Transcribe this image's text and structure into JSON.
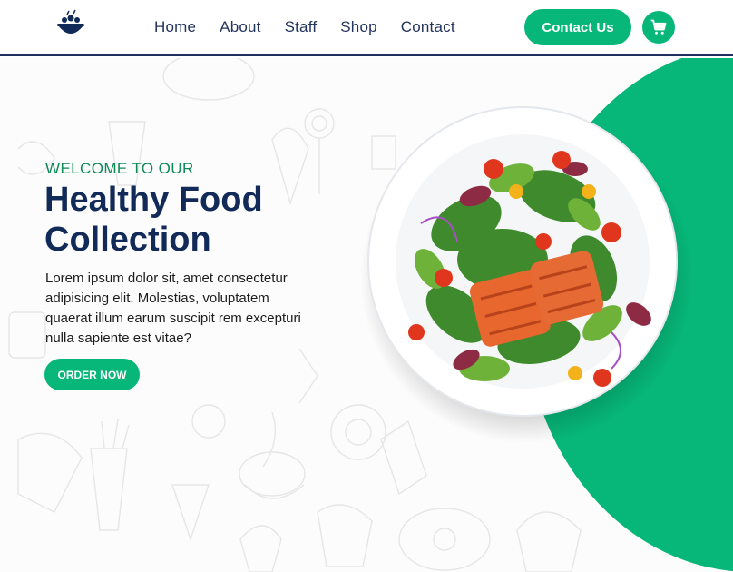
{
  "nav": {
    "items": [
      {
        "label": "Home"
      },
      {
        "label": "About"
      },
      {
        "label": "Staff"
      },
      {
        "label": "Shop"
      },
      {
        "label": "Contact"
      }
    ],
    "contact_button": "Contact Us",
    "cart_icon": "cart-icon",
    "logo_icon": "salad-bowl-logo"
  },
  "hero": {
    "welcome": "WELCOME TO OUR",
    "title": "Healthy Food Collection",
    "description": "Lorem ipsum dolor sit, amet consectetur adipisicing elit. Molestias, voluptatem quaerat illum earum suscipit rem excepturi nulla sapiente est vitae?",
    "order_button": "ORDER NOW",
    "image": "salad-plate-image"
  },
  "colors": {
    "accent": "#07b679",
    "heading": "#112a57",
    "welcome": "#0d8a58",
    "nav_text": "#22335c"
  }
}
